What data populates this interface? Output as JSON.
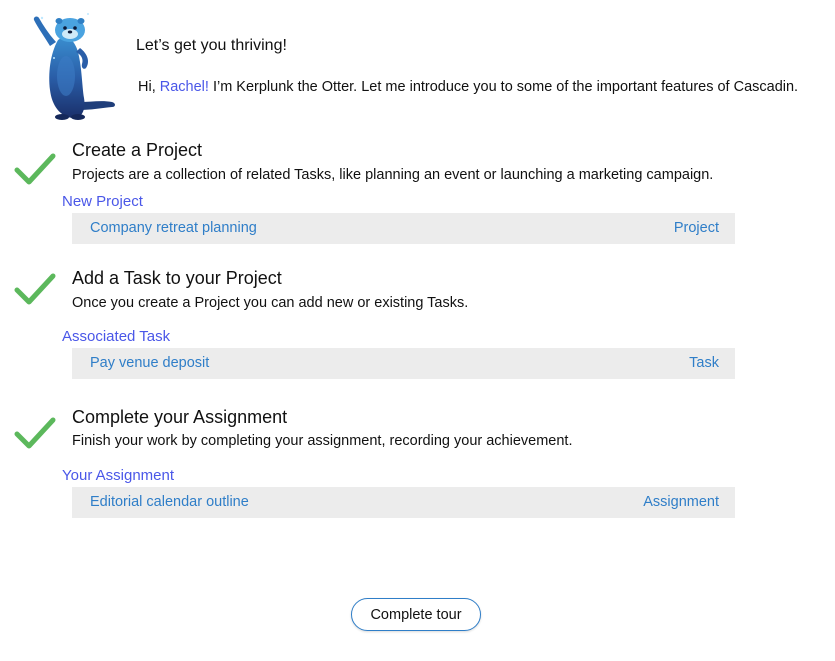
{
  "header": {
    "title": "Let’s get you thriving!",
    "intro_prefix": "Hi, ",
    "user_name": "Rachel!",
    "intro_suffix": " I’m Kerplunk the Otter. Let me introduce you to some of the important features of Cascadin.",
    "mascot_icon": "otter-mascot-icon"
  },
  "steps": [
    {
      "title": "Create a Project",
      "description": "Projects are a collection of related Tasks, like planning an event or launching a marketing campaign.",
      "field_label": "New Project",
      "record_name": "Company retreat planning",
      "record_type": "Project",
      "completed": true
    },
    {
      "title": "Add a Task to your Project",
      "description": "Once you create a Project you can add new or existing Tasks.",
      "field_label": "Associated Task",
      "record_name": "Pay venue deposit",
      "record_type": "Task",
      "completed": true
    },
    {
      "title": "Complete your Assignment",
      "description": "Finish your work by completing your assignment, recording your achievement.",
      "field_label": "Your Assignment",
      "record_name": "Editorial calendar outline",
      "record_type": "Assignment",
      "completed": true
    }
  ],
  "footer": {
    "complete_label": "Complete tour"
  },
  "colors": {
    "link_accent": "#4a57e8",
    "record_text": "#2f7ec8",
    "record_background": "#ececec",
    "check": "#5cb85c"
  }
}
